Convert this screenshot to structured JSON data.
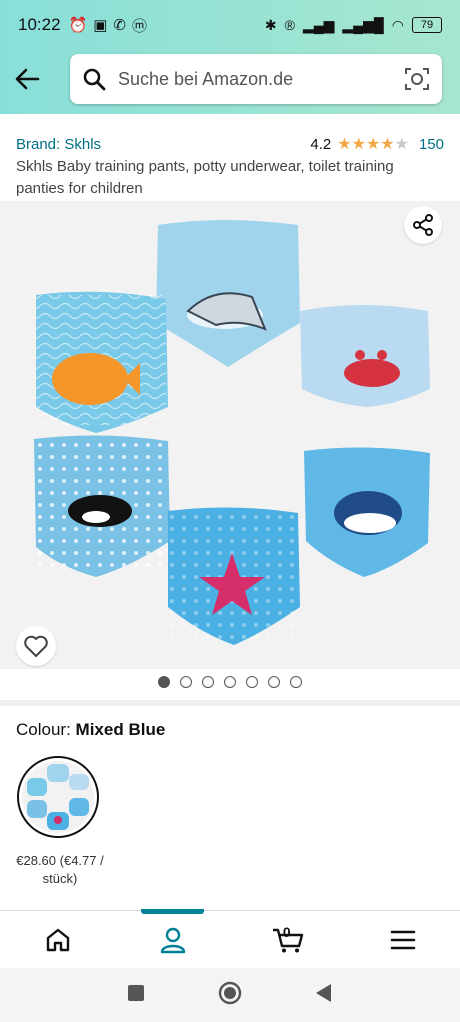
{
  "status_bar": {
    "time": "10:22",
    "battery": "79",
    "left_icons": [
      "alarm-icon",
      "nfc-icon",
      "whatsapp-icon",
      "messenger-icon"
    ],
    "right_icons": [
      "bluetooth-icon",
      "r-icon",
      "signal-icon",
      "signal-icon",
      "wifi-icon",
      "battery-icon"
    ]
  },
  "header": {
    "search_placeholder": "Suche bei Amazon.de"
  },
  "product": {
    "brand": "Brand: Skhls",
    "rating": "4.2",
    "rating_value": 4.2,
    "rating_max": 5,
    "review_count": "150",
    "title": "Skhls Baby training pants, potty underwear, toilet training panties for children"
  },
  "gallery": {
    "image_count": 7,
    "active_index": 0
  },
  "variation": {
    "label": "Colour:",
    "value": "Mixed Blue",
    "price": "€28.60",
    "unit_price": "(€4.77 / stück)"
  },
  "bottom_nav": {
    "items": [
      "home-icon",
      "account-icon",
      "cart-icon",
      "menu-icon"
    ],
    "active": "account-icon",
    "cart_count": "0"
  },
  "colors": {
    "accent": "#008296",
    "link": "#007185",
    "star": "#f3a847",
    "header_gradient_start": "#88dfd9",
    "header_gradient_end": "#a7e6cf"
  }
}
